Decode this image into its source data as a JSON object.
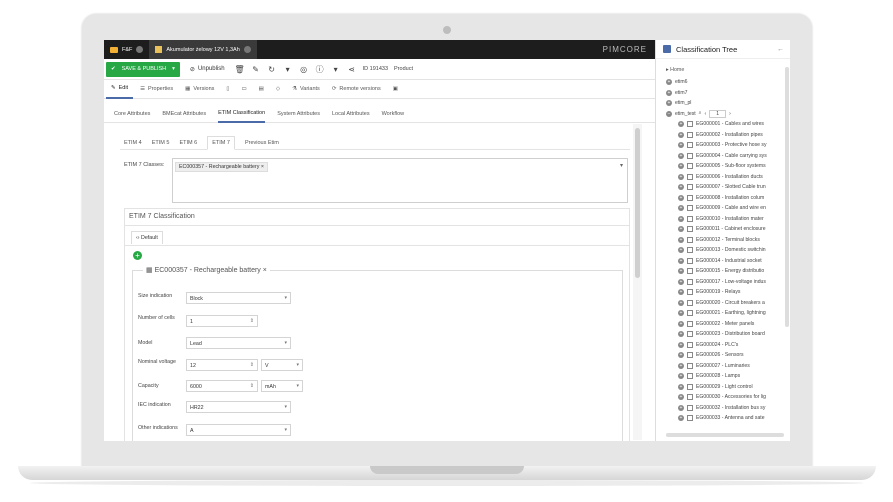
{
  "tabs": [
    {
      "label": "F&F"
    },
    {
      "label": "Akumulator żelowy 12V 1,3Ah"
    }
  ],
  "brand": "PIMCORE",
  "toolbar": {
    "save_label": "SAVE & PUBLISH",
    "unpublish_label": "Unpublish",
    "id_label": "ID 191433",
    "type_label": "Product"
  },
  "edit_tabs": [
    {
      "label": "Edit"
    },
    {
      "label": "Properties"
    },
    {
      "label": "Versions"
    },
    {
      "label": "Variants"
    },
    {
      "label": "Remote versions"
    }
  ],
  "section_tabs": [
    "Core Attributes",
    "BMEcat Attributes",
    "ETIM Classification",
    "System Attributes",
    "Local Attributes",
    "Workflow"
  ],
  "etim_tabs": [
    "ETIM 4",
    "ETIM 5",
    "ETIM 6",
    "ETIM 7",
    "Previous Etim"
  ],
  "classes": {
    "label": "ETIM 7 Classes:",
    "chip": "EC000357 - Rechargeable battery"
  },
  "panel": {
    "title": "ETIM 7 Classification",
    "subtab": "Default",
    "legend": "EC000357 - Rechargeable battery"
  },
  "fields": [
    {
      "label": "Size indication",
      "value": "Block",
      "type": "select"
    },
    {
      "label": "Number of cells",
      "value": "1",
      "type": "number"
    },
    {
      "label": "Model",
      "value": "Lead",
      "type": "select"
    },
    {
      "label": "Nominal voltage",
      "value": "12",
      "unit": "V",
      "type": "number-unit"
    },
    {
      "label": "Capacity",
      "value": "6000",
      "unit": "mAh",
      "type": "number-unit"
    },
    {
      "label": "IEC indication",
      "value": "HR22",
      "type": "select"
    },
    {
      "label": "Other indications",
      "value": "A",
      "type": "select"
    }
  ],
  "right_panel": {
    "title": "Classification Tree",
    "home": "Home",
    "roots": [
      "etim6",
      "etim7",
      "etim_pl",
      "etim_test"
    ],
    "search_page": "1",
    "nodes": [
      "EG000001 - Cables and wires",
      "EG000002 - Installation pipes",
      "EG000003 - Protective hose sy",
      "EG000004 - Cable carrying sys",
      "EG000005 - Sub-floor systems",
      "EG000006 - Installation ducts",
      "EG000007 - Slotted Cable trun",
      "EG000008 - Installation colum",
      "EG000009 - Cable and wire en",
      "EG000010 - Installation mater",
      "EG000011 - Cabinet enclosure",
      "EG000012 - Terminal blocks",
      "EG000013 - Domestic switchin",
      "EG000014 - Industrial socket",
      "EG000015 - Energy distributio",
      "EG000017 - Low-voltage indus",
      "EG000019 - Relays",
      "EG000020 - Circuit breakers a",
      "EG000021 - Earthing, lightning",
      "EG000022 - Meter panels",
      "EG000023 - Distribution board",
      "EG000024 - PLC's",
      "EG000026 - Sensors",
      "EG000027 - Luminaries",
      "EG000028 - Lamps",
      "EG000029 - Light control",
      "EG000030 - Accessories for lig",
      "EG000032 - Installation bus sy",
      "EG000033 - Antenna and sate"
    ]
  },
  "colors": {
    "accent": "#27a845",
    "topbar": "#1d1d1d",
    "tab_active": "#4a6aa8"
  }
}
